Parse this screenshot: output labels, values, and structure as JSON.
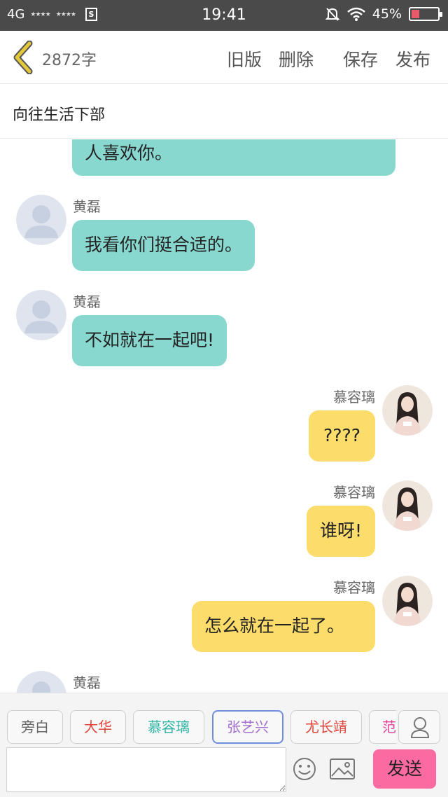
{
  "status_bar": {
    "network": "4G",
    "signal1": "★★★★",
    "signal2": "★★★★",
    "sim_icon_label": "S",
    "time": "19:41",
    "battery": "45%",
    "battery_level": 0.3,
    "icons": [
      "mute-bell-icon",
      "wifi-icon",
      "battery-icon"
    ]
  },
  "header": {
    "word_count": "2872字",
    "buttons": {
      "old_version": "旧版",
      "delete": "删除",
      "save": "保存",
      "publish": "发布"
    }
  },
  "title": "向往生活下部",
  "messages": [
    {
      "side": "left",
      "speaker": "",
      "text": "人喜欢你。",
      "avatar": "default-avatar-icon"
    },
    {
      "side": "left",
      "speaker": "黄磊",
      "text": "我看你们挺合适的。",
      "avatar": "default-avatar-icon"
    },
    {
      "side": "left",
      "speaker": "黄磊",
      "text": "不如就在一起吧!",
      "avatar": "default-avatar-icon"
    },
    {
      "side": "right",
      "speaker": "慕容璃",
      "text": "????",
      "avatar": "character-portrait-icon"
    },
    {
      "side": "right",
      "speaker": "慕容璃",
      "text": "谁呀!",
      "avatar": "character-portrait-icon"
    },
    {
      "side": "right",
      "speaker": "慕容璃",
      "text": "怎么就在一起了。",
      "avatar": "character-portrait-icon"
    },
    {
      "side": "left",
      "speaker": "黄磊",
      "text": "",
      "avatar": "default-avatar-icon"
    }
  ],
  "characters": [
    {
      "label": "旁白",
      "color": "#666666"
    },
    {
      "label": "大华",
      "color": "#e0443a"
    },
    {
      "label": "慕容璃",
      "color": "#2fb5a4"
    },
    {
      "label": "张艺兴",
      "color": "#a36fd0"
    },
    {
      "label": "尤长靖",
      "color": "#e0443a"
    },
    {
      "label": "范",
      "color": "#e0449a"
    }
  ],
  "selected_character": "张艺兴",
  "input": {
    "value": "",
    "placeholder": ""
  },
  "send_label": "发送",
  "colors": {
    "status_bar": "#4a4a4a",
    "left_bubble": "#89d8d0",
    "right_bubble": "#fcdc6b",
    "send_button": "#fb6aa0",
    "back_chevron": "#e2c83a",
    "selected_chip_border": "#6f8ed9"
  }
}
